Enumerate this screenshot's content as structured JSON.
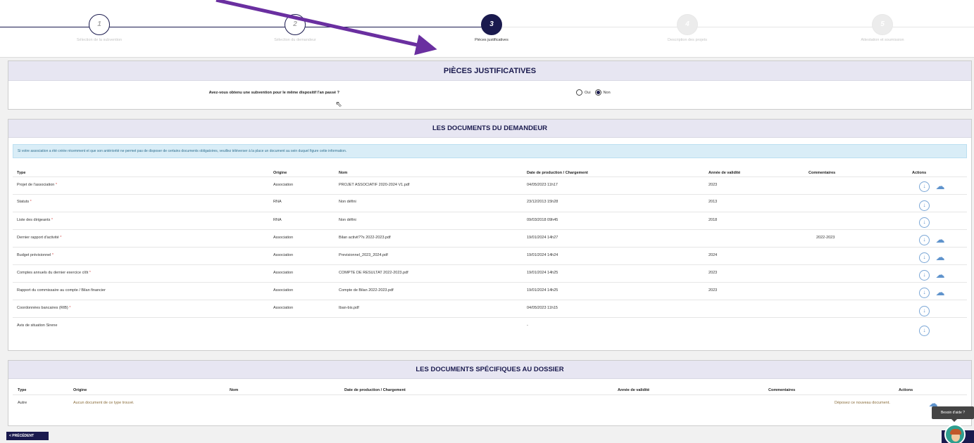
{
  "stepper": {
    "steps": [
      {
        "number": "1",
        "label": "Sélection de la subvention"
      },
      {
        "number": "2",
        "label": "Sélection du demandeur"
      },
      {
        "number": "3",
        "label": "Pièces justificatives"
      },
      {
        "number": "4",
        "label": "Description des projets"
      },
      {
        "number": "5",
        "label": "Attestation et soumission"
      }
    ]
  },
  "pieces": {
    "title": "PIÈCES JUSTIFICATIVES",
    "question": "Avez-vous obtenu une subvention pour le même dispositif l'an passé ?",
    "option_oui": "Oui",
    "option_non": "Non"
  },
  "demandeur": {
    "title": "LES DOCUMENTS DU DEMANDEUR",
    "info": "Si votre association a été créée récemment et que son antériorité ne permet pas de disposer de certains documents obligatoires, veuillez téléverser à la place un document au sein duquel figure cette information.",
    "headers": {
      "type": "Type",
      "origine": "Origine",
      "nom": "Nom",
      "date": "Date de production / Chargement",
      "annee": "Année de validité",
      "commentaires": "Commentaires",
      "actions": "Actions"
    },
    "rows": [
      {
        "type": "Projet de l'association",
        "origine": "Association",
        "nom": "PROJET ASSOCIATIF 2020-2024 V1.pdf",
        "date": "04/05/2023 11h17",
        "annee": "2023",
        "commentaire": ""
      },
      {
        "type": "Statuts",
        "origine": "RNA",
        "nom": "Non défini",
        "date": "23/12/2013 15h28",
        "annee": "2013",
        "commentaire": ""
      },
      {
        "type": "Liste des dirigeants",
        "origine": "RNA",
        "nom": "Non défini",
        "date": "09/03/2018 09h45",
        "annee": "2018",
        "commentaire": ""
      },
      {
        "type": "Dernier rapport d'activité",
        "origine": "Association",
        "nom": "Bilan activit??s 2022-2023.pdf",
        "date": "19/01/2024 14h27",
        "annee": "",
        "commentaire": "2022-2023"
      },
      {
        "type": "Budget prévisionnel",
        "origine": "Association",
        "nom": "Previsionnel_2023_2024.pdf",
        "date": "19/01/2024 14h24",
        "annee": "2024",
        "commentaire": ""
      },
      {
        "type": "Comptes annuels du dernier exercice clôt",
        "origine": "Association",
        "nom": "COMPTE DE RESULTAT 2022-2023.pdf",
        "date": "19/01/2024 14h25",
        "annee": "2023",
        "commentaire": ""
      },
      {
        "type": "Rapport du commissaire au compte / Bilan financier",
        "origine": "Association",
        "nom": "Compte de Bilan 2022-2023.pdf",
        "date": "19/01/2024 14h25",
        "annee": "2023",
        "commentaire": ""
      },
      {
        "type": "Coordonnées bancaires (RIB)",
        "origine": "Association",
        "nom": "Iban-bis.pdf",
        "date": "04/05/2023 11h15",
        "annee": "",
        "commentaire": ""
      },
      {
        "type": "Avis de situation Sirene",
        "origine": "",
        "nom": "",
        "date": "-",
        "annee": "",
        "commentaire": ""
      }
    ]
  },
  "specifiques": {
    "title": "LES DOCUMENTS SPÉCIFIQUES AU DOSSIER",
    "headers": {
      "type": "Type",
      "origine": "Origine",
      "nom": "Nom",
      "date": "Date de production / Chargement",
      "annee": "Année de validité",
      "commentaires": "Commentaires",
      "actions": "Actions"
    },
    "row": {
      "type": "Autre",
      "origine": "Aucun document de ce type trouvé.",
      "action_text": "Déposez ce nouveau document."
    }
  },
  "footer": {
    "prev_label": "< PRÉCÉDENT",
    "help_label": "Besoin d'aide ?"
  },
  "colors": {
    "primary": "#1a1a4e",
    "header_bg": "#e7e6f2",
    "info_bg": "#d9edf7",
    "required": "#d9534f",
    "annotation_arrow": "#6a2fa0"
  }
}
